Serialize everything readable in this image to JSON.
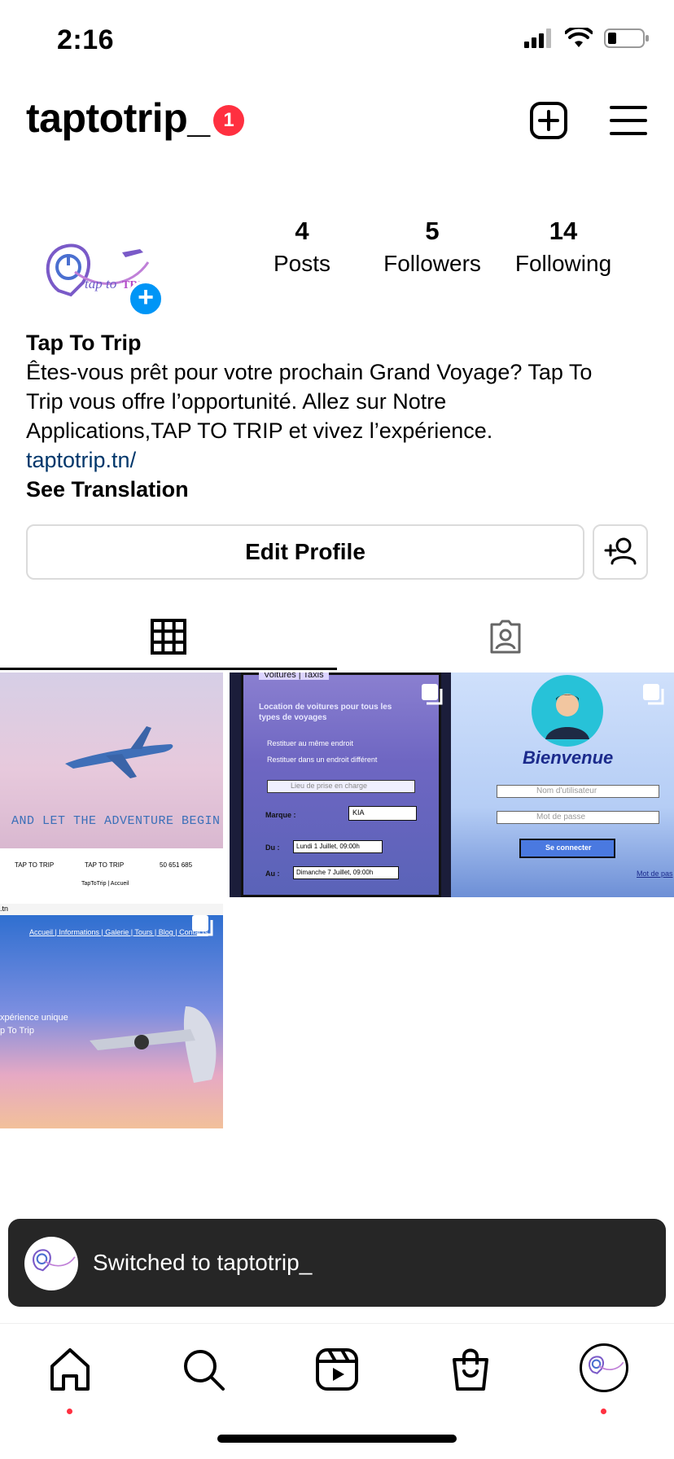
{
  "status_bar": {
    "time": "2:16"
  },
  "header": {
    "username": "taptotrip_",
    "notification_count": "1"
  },
  "profile": {
    "stats": [
      {
        "value": "4",
        "label": "Posts"
      },
      {
        "value": "5",
        "label": "Followers"
      },
      {
        "value": "14",
        "label": "Following"
      }
    ],
    "name": "Tap To Trip",
    "bio_lines": [
      "Êtes-vous prêt pour votre prochain Grand Voyage? Tap To",
      "Trip vous offre l’opportunité. Allez sur Notre",
      "Applications,TAP TO TRIP et vivez l’expérience."
    ],
    "link": "taptotrip.tn/",
    "see_translation": "See Translation",
    "edit_profile_label": "Edit Profile"
  },
  "posts": [
    {
      "caption": "AND LET THE ADVENTURE BEGIN",
      "contact_1": "TAP TO TRIP",
      "contact_2": "TAP TO TRIP",
      "phone": "50 651 685",
      "footer": "TapToTrip | Accueil"
    },
    {
      "tabs": "Voitures | Taxis",
      "title": "Location de voitures pour tous les types de voyages",
      "option_1": "Restituer au même endroit",
      "option_2": "Restituer dans un endroit différent",
      "pickup_placeholder": "Lieu de prise en charge",
      "marque_label": "Marque :",
      "marque_value": "KIA",
      "du_label": "Du :",
      "du_value": "Lundi 1 Juillet, 09:00h",
      "au_label": "Au :",
      "au_value": "Dimanche 7 Juillet, 09:00h"
    },
    {
      "title": "Bienvenue",
      "username_placeholder": "Nom d'utilisateur",
      "password_placeholder": "Mot de passe",
      "login_button": "Se connecter",
      "forgot_link": "Mot de pas"
    },
    {
      "url_fragment": ".tn",
      "nav": "Accueil | Informations | Galerie | Tours | Blog | Contacts",
      "tagline_1": "xpérience unique",
      "tagline_2": "p To Trip"
    }
  ],
  "toast": {
    "message": "Switched to taptotrip_"
  },
  "logo": {
    "text": "tap to TRIP"
  },
  "colors": {
    "accent": "#0095f6",
    "badge": "#ff3040",
    "link": "#00376b",
    "toast_bg": "#262626"
  },
  "icons": [
    "signal-icon",
    "wifi-icon",
    "battery-icon",
    "plus-square-icon",
    "menu-icon",
    "add-person-icon",
    "grid-icon",
    "tagged-icon",
    "home-icon",
    "search-icon",
    "reels-icon",
    "shop-icon"
  ]
}
